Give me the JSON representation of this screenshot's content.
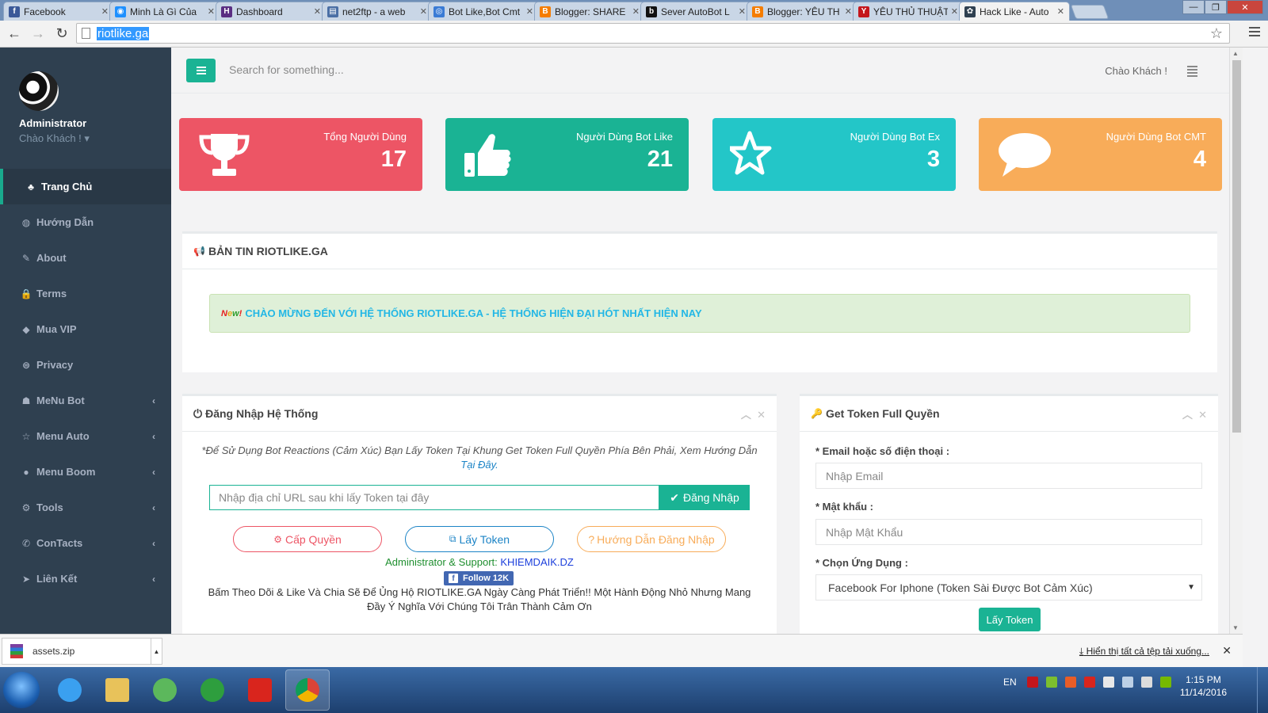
{
  "browser": {
    "tabs": [
      {
        "title": "Facebook",
        "color": "#3b5998",
        "glyph": "f"
      },
      {
        "title": "Minh Là Gì Của",
        "color": "#1e90ff",
        "glyph": "◉"
      },
      {
        "title": "Dashboard",
        "color": "#5a2d82",
        "glyph": "H"
      },
      {
        "title": "net2ftp - a web",
        "color": "#4a6fa5",
        "glyph": "▤"
      },
      {
        "title": "Bot Like,Bot Cmt",
        "color": "#3a7bd5",
        "glyph": "◎"
      },
      {
        "title": "Blogger: SHARE",
        "color": "#f57d00",
        "glyph": "B"
      },
      {
        "title": "Sever AutoBot L",
        "color": "#111111",
        "glyph": "b"
      },
      {
        "title": "Blogger: YÊU TH",
        "color": "#f57d00",
        "glyph": "B"
      },
      {
        "title": "YÊU THỦ THUẬT",
        "color": "#c4161c",
        "glyph": "Y"
      },
      {
        "title": "Hack Like - Auto",
        "color": "#2f4050",
        "glyph": "✿"
      }
    ],
    "active_tab": 9,
    "url": "riotlike.ga"
  },
  "sidebar": {
    "profile_name": "Administrator",
    "profile_greeting": "Chào Khách ! ▾",
    "items": [
      {
        "label": "Trang Chủ",
        "icon": "♣",
        "active": true
      },
      {
        "label": "Hướng Dẫn",
        "icon": "◍"
      },
      {
        "label": "About",
        "icon": "✎"
      },
      {
        "label": "Terms",
        "icon": "🔒"
      },
      {
        "label": "Mua VIP",
        "icon": "◆"
      },
      {
        "label": "Privacy",
        "icon": "⊜"
      },
      {
        "label": "MeNu Bot",
        "icon": "☗",
        "chevron": "‹"
      },
      {
        "label": "Menu Auto",
        "icon": "☆",
        "chevron": "‹"
      },
      {
        "label": "Menu Boom",
        "icon": "●",
        "chevron": "‹"
      },
      {
        "label": "Tools",
        "icon": "⚙",
        "chevron": "‹"
      },
      {
        "label": "ConTacts",
        "icon": "✆",
        "chevron": "‹"
      },
      {
        "label": "Liên Kết",
        "icon": "➤",
        "chevron": "‹"
      }
    ]
  },
  "header": {
    "search_placeholder": "Search for something...",
    "greeting": "Chào Khách !"
  },
  "stats": [
    {
      "label": "Tổng Người Dùng",
      "value": "17",
      "color": "#ed5565",
      "icon": "trophy-icon"
    },
    {
      "label": "Người Dùng Bot Like",
      "value": "21",
      "color": "#1ab394",
      "icon": "thumbs-up-icon"
    },
    {
      "label": "Người Dùng Bot Ex",
      "value": "3",
      "color": "#23c6c8",
      "icon": "star-icon"
    },
    {
      "label": "Người Dùng Bot CMT",
      "value": "4",
      "color": "#f8ac59",
      "icon": "comment-icon"
    }
  ],
  "news": {
    "title": "BẢN TIN RIOTLIKE.GA",
    "badge": [
      "N",
      "e",
      "w",
      "!"
    ],
    "message": "CHÀO MỪNG ĐẾN VỚI HỆ THỐNG RIOTLIKE.GA - HỆ THỐNG HIỆN ĐẠI HÓT NHẤT HIỆN NAY"
  },
  "login": {
    "title": "Đăng Nhập Hệ Thống",
    "note": "*Để Sử Dụng Bot Reactions (Cảm Xúc) Bạn Lấy Token Tại Khung Get Token Full Quyền Phía Bên Phải, Xem Hướng Dẫn",
    "note_link": "Tại Đây.",
    "input_placeholder": "Nhập địa chỉ URL sau khi lấy Token tại đây",
    "login_button": "Đăng Nhập",
    "grant_button": "Cấp Quyền",
    "token_button": "Lấy Token",
    "guide_button": "Hướng Dẫn Đăng Nhập",
    "admin_prefix": "Administrator & Support:",
    "admin_name": "KHIEMDAIK.DZ",
    "follow_label": "Follow 12K",
    "thanks": "Bấm Theo Dõi & Like Và Chia Sẽ Để Ủng Hộ RIOTLIKE.GA Ngày Càng Phát Triển!! Một Hành Động Nhỏ Nhưng Mang Đầy Ý Nghĩa Với Chúng Tôi Trân Thành Cảm Ơn"
  },
  "token": {
    "title": "Get Token Full Quyền",
    "email_label": "* Email hoặc số điện thoại :",
    "email_placeholder": "Nhập Email",
    "password_label": "* Mật khẩu :",
    "password_placeholder": "Nhập Mật Khẩu",
    "app_label": "* Chọn Ứng Dụng :",
    "app_selected": "Facebook For Iphone (Token Sài Được Bot Cảm Xúc)",
    "submit": "Lấy Token"
  },
  "downloads": {
    "file": "assets.zip",
    "show_all": "Hiển thị tất cả tệp tải xuống..."
  },
  "taskbar": {
    "lang": "EN",
    "time": "1:15 PM",
    "date": "11/14/2016"
  }
}
